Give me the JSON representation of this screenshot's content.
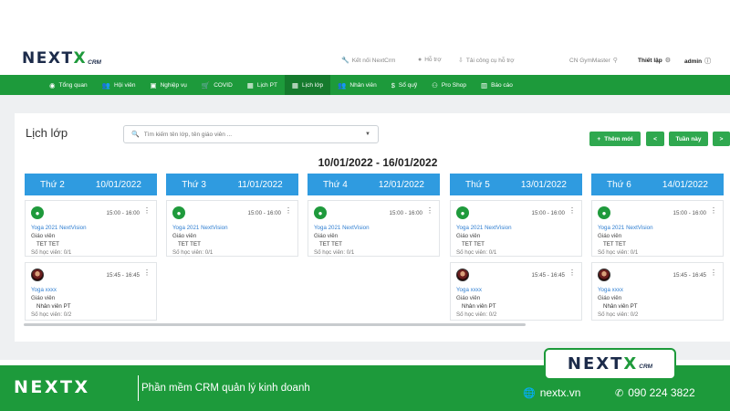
{
  "header": {
    "logo_text": "NEXT",
    "logo_x": "X",
    "logo_crm": "CRM",
    "connect_label": "Kết nối NextCrm",
    "support_label": "Hỗ trợ",
    "guide_label": "Tải công cụ hỗ trợ",
    "branch": "CN GymMaster",
    "settings_label": "Thiết lập",
    "user": "admin"
  },
  "nav": {
    "items": [
      {
        "label": "Tổng quan",
        "icon": "eye-icon"
      },
      {
        "label": "Hội viên",
        "icon": "members-icon"
      },
      {
        "label": "Nghiệp vụ",
        "icon": "briefcase-icon"
      },
      {
        "label": "COVID",
        "icon": "cart-icon"
      },
      {
        "label": "Lịch PT",
        "icon": "calendar-icon"
      },
      {
        "label": "Lịch lớp",
        "icon": "calendar-icon"
      },
      {
        "label": "Nhân viên",
        "icon": "staff-icon"
      },
      {
        "label": "Sổ quỹ",
        "icon": "dollar-icon"
      },
      {
        "label": "Pro Shop",
        "icon": "shop-icon"
      },
      {
        "label": "Báo cáo",
        "icon": "chart-icon"
      }
    ],
    "active_index": 5
  },
  "main": {
    "title": "Lịch lớp",
    "search_placeholder": "Tìm kiếm tên lớp, tên giáo viên ...",
    "add_label": "Thêm mới",
    "prev_label": "<",
    "week_label": "Tuần này",
    "next_label": ">",
    "date_range": "10/01/2022 - 16/01/2022",
    "days": [
      {
        "name": "Thứ 2",
        "date": "10/01/2022"
      },
      {
        "name": "Thứ 3",
        "date": "11/01/2022"
      },
      {
        "name": "Thứ 4",
        "date": "12/01/2022"
      },
      {
        "name": "Thứ 5",
        "date": "13/01/2022"
      },
      {
        "name": "Thứ 6",
        "date": "14/01/2022"
      }
    ],
    "class_a": {
      "time": "15:00 - 16:00",
      "name": "Yoga 2021 NextVision",
      "teacher_label": "Giáo viên",
      "teacher": "TET TET",
      "count": "Số học viên: 0/1"
    },
    "class_b": {
      "time": "15:45 - 16:45",
      "name": "Yoga xxxx",
      "teacher_label": "Giáo viên",
      "teacher": "Nhân viên PT",
      "count": "Số học viên: 0/2"
    }
  },
  "banner": {
    "logo_text": "NEXT",
    "logo_x": "X",
    "tagline": "Phần mềm CRM quản lý kinh doanh",
    "badge_text": "NEXT",
    "badge_x": "X",
    "badge_crm": "CRM",
    "website": "nextx.vn",
    "phone": "090 224 3822"
  },
  "colors": {
    "brand_green": "#1d9a3b",
    "day_header_blue": "#2f9be0",
    "button_green": "#2fa84f",
    "navy": "#1c2b4a"
  }
}
